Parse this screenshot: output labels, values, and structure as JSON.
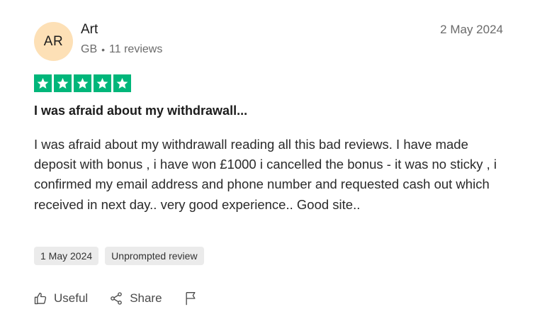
{
  "reviewer": {
    "initials": "AR",
    "name": "Art",
    "country": "GB",
    "separator": "•",
    "review_count": "11 reviews"
  },
  "review": {
    "date": "2 May 2024",
    "rating": 5,
    "rating_max": 5,
    "star_color": "#00b67a",
    "title": "I was afraid about my withdrawall...",
    "body": "I was afraid about my withdrawall reading all this bad reviews. I have made deposit with bonus , i have won £1000 i cancelled the bonus - it was no sticky , i confirmed my email address and phone number and requested cash out which received in next day.. very good experience.. Good site..",
    "experience_date": "1 May 2024",
    "badge": "Unprompted review"
  },
  "actions": {
    "useful_label": "Useful",
    "useful_icon": "thumbs-up-icon",
    "share_label": "Share",
    "share_icon": "share-icon",
    "report_icon": "flag-icon"
  },
  "colors": {
    "avatar_bg": "#fde0b6",
    "tag_bg": "#ebebeb",
    "muted_text": "#6b6b6b"
  }
}
